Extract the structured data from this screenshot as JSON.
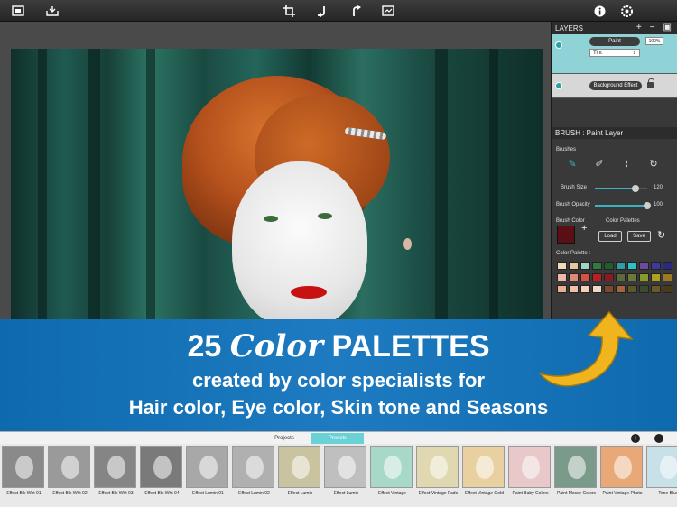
{
  "toolbar": {
    "left_icons": [
      "gallery-icon",
      "save-icon"
    ],
    "center_icons": [
      "crop-icon",
      "undo-icon",
      "redo-icon",
      "compare-icon"
    ],
    "right_icons": [
      "info-icon",
      "settings-icon"
    ]
  },
  "layers": {
    "title": "LAYERS",
    "items": [
      {
        "name": "Paint",
        "opacity": "100%",
        "blend": "Tint"
      },
      {
        "name": "Background Effect"
      }
    ]
  },
  "brush": {
    "header": "BRUSH : Paint Layer",
    "brushes_label": "Brushes",
    "size_label": "Brush Size",
    "size_value": "120",
    "size_fraction": 0.78,
    "opacity_label": "Brush Opacity",
    "opacity_value": "100",
    "opacity_fraction": 1.0,
    "color_label": "Brush Color",
    "palettes_label": "Color Palettes",
    "load_label": "Load",
    "save_label": "Save",
    "palette_label": "Color Palette :",
    "current_color": "#5a0f12",
    "palette": [
      "#f2d9b8",
      "#e6c89c",
      "#9fd7c4",
      "#2f7a3c",
      "#1f5f2d",
      "#2f9ea4",
      "#2bc2c7",
      "#6b4aa0",
      "#3a3aa0",
      "#2a2a86",
      "#f0b8a8",
      "#e08878",
      "#d85040",
      "#b82020",
      "#8a1a22",
      "#5a6a3a",
      "#6a7a3a",
      "#8a9a2a",
      "#b0a020",
      "#9a7a20",
      "#e8b090",
      "#f0c0a8",
      "#f4d0b8",
      "#f0d8c8",
      "#7a4a2a",
      "#a8643a",
      "#5a5a2a",
      "#3a4a2a",
      "#6a5a2a",
      "#4a3a1a"
    ]
  },
  "banner": {
    "count": "25",
    "color_word": "Color",
    "palettes_word": "PALETTES",
    "line2": "created by color specialists for",
    "line3": "Hair color, Eye color, Skin tone and Seasons"
  },
  "tabs": {
    "projects": "Projects",
    "presets": "Presets"
  },
  "presets": [
    {
      "title": "Effect Blk Wht 01"
    },
    {
      "title": "Effect Blk Wht 02"
    },
    {
      "title": "Effect Blk Wht 03"
    },
    {
      "title": "Effect Blk Wht 04"
    },
    {
      "title": "Effect Lumin 01"
    },
    {
      "title": "Effect Lumin 02"
    },
    {
      "title": "Effect Lumin"
    },
    {
      "title": "Effect Lumin"
    },
    {
      "title": "Effect Vintage"
    },
    {
      "title": "Effect Vintage Fade"
    },
    {
      "title": "Effect Vintage Gold"
    },
    {
      "title": "Paint Baby Colors"
    },
    {
      "title": "Paint Mossy Colors"
    },
    {
      "title": "Paint Vintage Photo"
    },
    {
      "title": "Tone Blue"
    }
  ],
  "preset_tints": [
    "#8a8a8a",
    "#9a9a9a",
    "#858585",
    "#7a7a7a",
    "#a8a8a8",
    "#b0b0b0",
    "#c9c3a0",
    "#bfbfbf",
    "#a8d8c8",
    "#e0d8b0",
    "#e8d0a0",
    "#e8c8c8",
    "#7a9a8a",
    "#e8a878",
    "#c8e0e8"
  ]
}
